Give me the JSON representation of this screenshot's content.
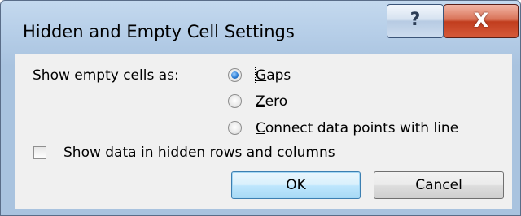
{
  "dialog": {
    "title": "Hidden and Empty Cell Settings",
    "help_glyph": "?",
    "close_glyph": "X"
  },
  "show_empty": {
    "label": "Show empty cells as:",
    "options": [
      {
        "pre": "",
        "key": "G",
        "rest": "aps",
        "checked": true
      },
      {
        "pre": "",
        "key": "Z",
        "rest": "ero",
        "checked": false
      },
      {
        "pre": "",
        "key": "C",
        "rest": "onnect data points with line",
        "checked": false
      }
    ]
  },
  "hidden_rows": {
    "pre": "Show data in ",
    "key": "h",
    "rest": "idden rows and columns",
    "checked": false
  },
  "buttons": {
    "ok": "OK",
    "cancel": "Cancel"
  }
}
